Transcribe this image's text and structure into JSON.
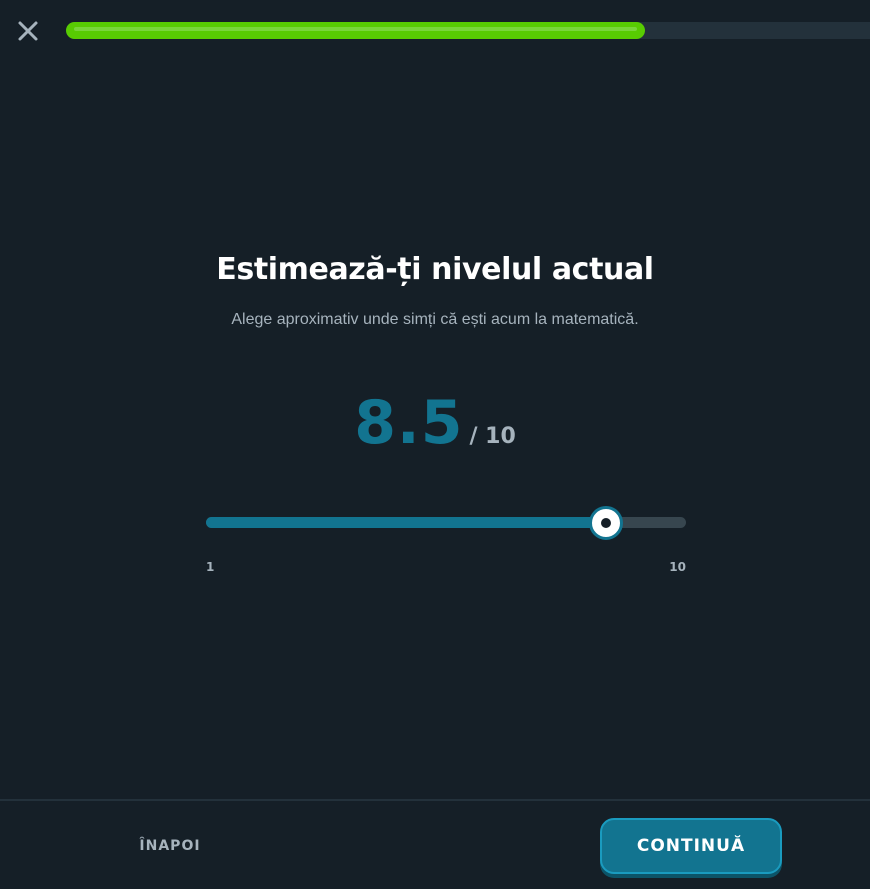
{
  "header": {
    "close_icon": "close-icon",
    "progress": 0.72
  },
  "main": {
    "title": "Estimează-ți nivelul actual",
    "subtitle": "Alege aproximativ unde simți că ești acum la matematică.",
    "score_value": "8.5",
    "score_max": "/ 10"
  },
  "slider": {
    "min": 1,
    "max": 10,
    "value": 8.5,
    "min_label": "1",
    "max_label": "10"
  },
  "footer": {
    "back_label": "ÎNAPOI",
    "continue_label": "CONTINUĂ"
  },
  "colors": {
    "background": "#151f27",
    "progress_fill": "#58cc02",
    "accent": "#127490",
    "muted_text": "#a6b3bd",
    "track": "#37464f"
  }
}
